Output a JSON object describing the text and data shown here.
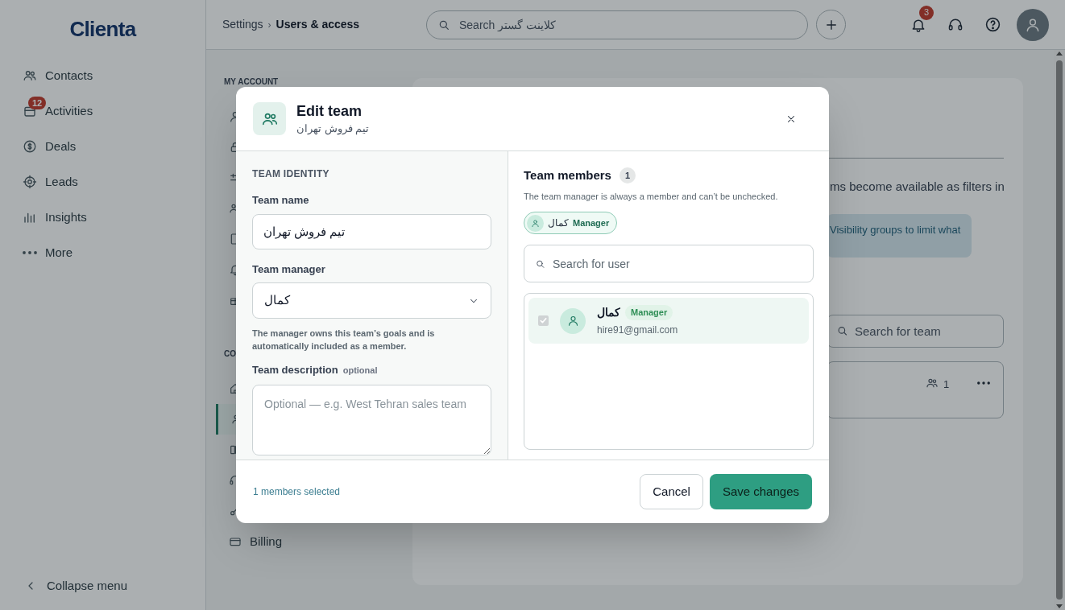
{
  "sidebar": {
    "logo": "Clienta",
    "items": [
      {
        "label": "Contacts"
      },
      {
        "label": "Activities",
        "badge": "12"
      },
      {
        "label": "Deals"
      },
      {
        "label": "Leads"
      },
      {
        "label": "Insights"
      },
      {
        "label": "More"
      }
    ],
    "collapse_label": "Collapse menu"
  },
  "topbar": {
    "breadcrumb": [
      "Settings",
      "Users & access"
    ],
    "breadcrumb_separator": "›",
    "search_placeholder": "Search کلاینت گستر",
    "notification_count": "3"
  },
  "settings_nav": {
    "sections": [
      {
        "heading": "MY ACCOUNT",
        "items": [
          {
            "selected": false
          },
          {
            "selected": false
          },
          {
            "selected": false
          },
          {
            "selected": false
          },
          {
            "selected": false
          },
          {
            "selected": false
          },
          {
            "selected": false
          }
        ]
      },
      {
        "heading": "CO",
        "items": [
          {
            "selected": false
          },
          {
            "selected": true
          },
          {
            "selected": false
          },
          {
            "selected": false
          },
          {
            "selected": false
          },
          {
            "label": "Billing",
            "selected": false
          }
        ]
      }
    ]
  },
  "content": {
    "description": "ms become available as filters in",
    "info": "Visibility groups to limit what",
    "team_search_placeholder": "Search for team",
    "team_rows": [
      {
        "member_count": "1"
      }
    ]
  },
  "modal": {
    "title": "Edit team",
    "subtitle": "تیم فروش تهران",
    "identity": {
      "heading": "TEAM IDENTITY",
      "name_label": "Team name",
      "name_value": "تیم فروش تهران",
      "manager_label": "Team manager",
      "manager_value": "کمال",
      "manager_help": "The manager owns this team’s goals and is automatically included as a member.",
      "description_label": "Team description",
      "description_optional": "optional",
      "description_placeholder": "Optional — e.g. West Tehran sales team"
    },
    "members": {
      "heading": "Team members",
      "count": "1",
      "help": "The team manager is always a member and can’t be unchecked.",
      "chips": [
        {
          "name": "کمال",
          "role": "Manager"
        }
      ],
      "search_placeholder": "Search for user",
      "users": [
        {
          "name": "کمال",
          "role": "Manager",
          "email": "hire91@gmail.com",
          "checked": true,
          "disabled": true,
          "selected": true
        }
      ]
    },
    "footer": {
      "selected_text": "1 members selected",
      "cancel": "Cancel",
      "save": "Save changes"
    }
  }
}
